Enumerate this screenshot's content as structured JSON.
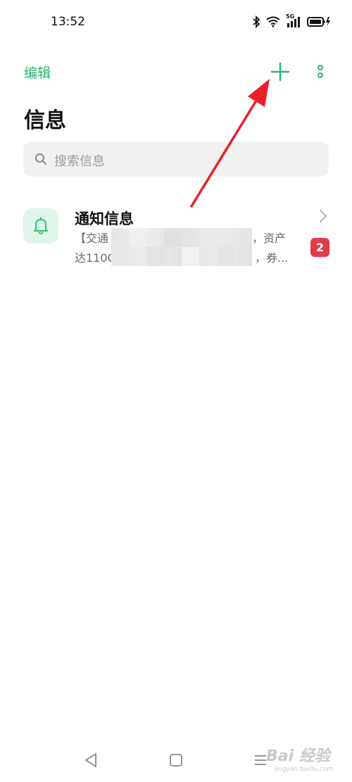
{
  "status_bar": {
    "time": "13:52",
    "network_label": "5G"
  },
  "header": {
    "edit_label": "编辑",
    "add_icon": "plus-icon",
    "more_icon": "more-vertical-icon",
    "accent_color": "#27b66e"
  },
  "page": {
    "title": "信息"
  },
  "search": {
    "placeholder": "搜索信息",
    "icon": "search-icon"
  },
  "conversations": [
    {
      "title": "通知信息",
      "preview_line1_start": "【交通",
      "preview_line1_end": "权，资产",
      "preview_line2_start": "达110C",
      "preview_line2_end": "，券...",
      "unread_count": "2",
      "icon": "bell-icon",
      "badge_color": "#e23b4a"
    }
  ],
  "watermark": {
    "text": "Bai 经验",
    "sub": "jingyan.baidu.com"
  }
}
